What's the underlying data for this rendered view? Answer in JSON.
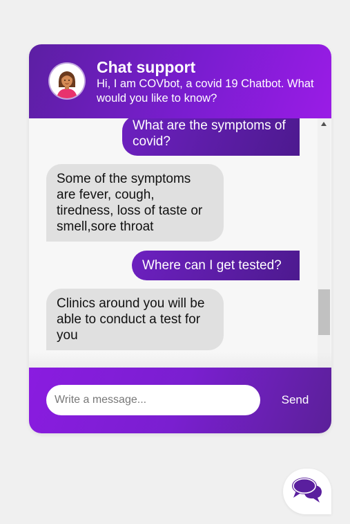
{
  "header": {
    "title": "Chat support",
    "subtitle": "Hi, I am COVbot, a covid 19 Chatbot. What would you like to know?",
    "avatar_icon": "female-avatar-icon"
  },
  "messages": [
    {
      "from": "user",
      "text": "What are the symptoms of covid?"
    },
    {
      "from": "bot",
      "text": "Some of the symptoms are fever, cough, tiredness, loss of taste or smell,sore throat"
    },
    {
      "from": "user",
      "text": "Where can I get tested?"
    },
    {
      "from": "bot",
      "text": "Clinics around you will be able to conduct a test for you"
    }
  ],
  "composer": {
    "placeholder": "Write a message...",
    "send_label": "Send"
  },
  "launcher": {
    "icon": "chat-bubbles-icon"
  },
  "colors": {
    "accent_purple": "#7a1dd0",
    "dark_purple": "#4d1a8f",
    "bot_bubble": "#e0e0e0",
    "page_bg": "#f0f0f0"
  }
}
